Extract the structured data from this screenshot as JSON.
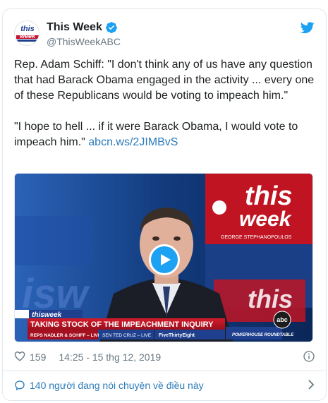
{
  "account": {
    "display_name": "This Week",
    "handle": "@ThisWeekABC",
    "avatar_text_top": "this",
    "avatar_text_bottom": "week"
  },
  "tweet": {
    "text": "Rep. Adam Schiff: \"I don't think any of us have any question that had Barack Obama engaged in the activity ... every one of these Republicans would be voting to impeach him.\"\n\n\"I hope to hell ... if it were Barack Obama, I would vote to impeach him.\" ",
    "link": "abcn.ws/2JIMBvS"
  },
  "media": {
    "lower_third_brand": "thisweek",
    "headline": "TAKING STOCK OF THE IMPEACHMENT INQUIRY",
    "ticker": [
      "REPS NADLER & SCHIFF – LIVE",
      "SEN TED CRUZ – LIVE",
      "FiveThirtyEight",
      "POWERHOUSE ROUNDTABLE"
    ],
    "set_logo_top": "this",
    "set_logo_bottom": "week",
    "set_subtitle": "GEORGE STEPHANOPOULOS",
    "corner_logo": "abc"
  },
  "footer": {
    "likes": "159",
    "timestamp": "14:25 - 15 thg 12, 2019",
    "conversation": "140 người đang nói chuyện về điều này"
  },
  "colors": {
    "link": "#2b7bb9",
    "twitter_blue": "#1da1f2",
    "muted": "#697882"
  }
}
